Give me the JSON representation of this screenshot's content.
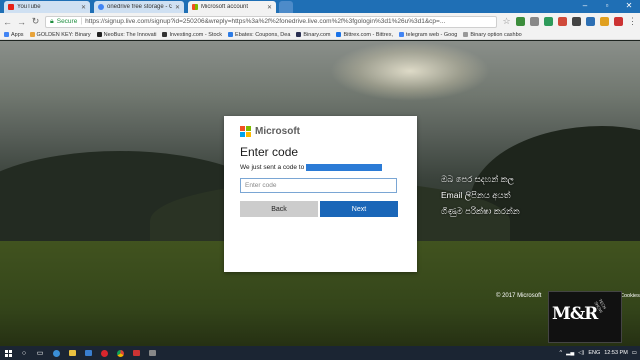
{
  "browser": {
    "tabs": [
      {
        "label": "YouTube",
        "active": false,
        "icon": "youtube-icon",
        "color": "#e62117"
      },
      {
        "label": "onedrive free storage - G",
        "active": false,
        "icon": "google-icon",
        "color": "#4285f4"
      },
      {
        "label": "Microsoft account",
        "active": true,
        "icon": "microsoft-icon",
        "color": "#f25022"
      }
    ],
    "secure_label": "Secure",
    "url": "https://signup.live.com/signup?id=250206&wreply=https%3a%2f%2fonedrive.live.com%2f%3fgologin%3d1%26u%3d1&cp=...",
    "apps_label": "Apps",
    "bookmarks": [
      {
        "label": "GOLDEN KEY: Binary",
        "color": "#e8a33a"
      },
      {
        "label": "NeoBux: The Innovati",
        "color": "#222222"
      },
      {
        "label": "Investing.com - Stock",
        "color": "#333333"
      },
      {
        "label": "Ebates: Coupons, Dea",
        "color": "#2c7be5"
      },
      {
        "label": "Binary.com",
        "color": "#2a3052"
      },
      {
        "label": "Bittrex.com - Bittrex,",
        "color": "#1a73e8"
      },
      {
        "label": "telegram web - Goog",
        "color": "#4285f4"
      },
      {
        "label": "Binary option cashbo",
        "color": "#999999"
      }
    ]
  },
  "dialog": {
    "brand": "Microsoft",
    "title": "Enter code",
    "description": "We just sent a code to",
    "input_placeholder": "Enter code",
    "back_label": "Back",
    "next_label": "Next",
    "accent_color": "#1a66b8"
  },
  "overlay": {
    "lines": [
      "ඔබ පෙර සදහන් කල",
      "Email ලිපිනය අයත්",
      "ගිණුම පරික්ෂා කරන්න"
    ]
  },
  "footer": {
    "copyright": "© 2017 Microsoft",
    "cookies": "Cookies"
  },
  "watermark": {
    "text": "M&R",
    "subtext": "TECH SHOW"
  },
  "taskbar": {
    "language": "ENG",
    "time": "12:53 PM"
  }
}
